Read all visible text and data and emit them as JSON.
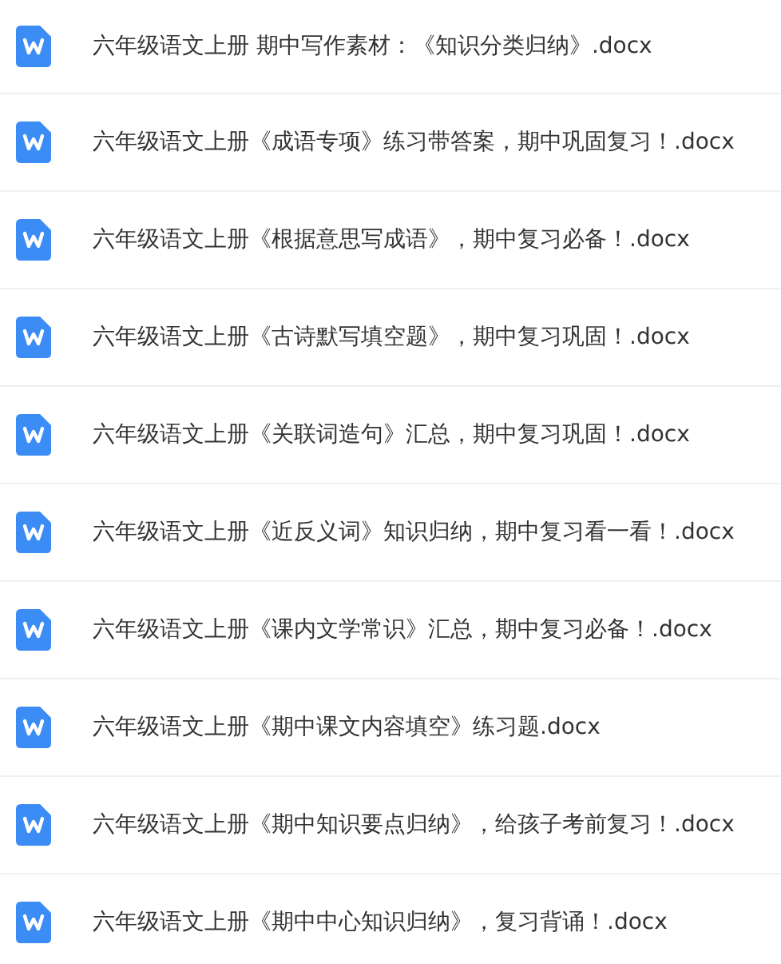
{
  "files": [
    {
      "name": "六年级语文上册 期中写作素材：《知识分类归纳》.docx"
    },
    {
      "name": "六年级语文上册《成语专项》练习带答案，期中巩固复习！.docx"
    },
    {
      "name": "六年级语文上册《根据意思写成语》，期中复习必备！.docx"
    },
    {
      "name": "六年级语文上册《古诗默写填空题》，期中复习巩固！.docx"
    },
    {
      "name": "六年级语文上册《关联词造句》汇总，期中复习巩固！.docx"
    },
    {
      "name": "六年级语文上册《近反义词》知识归纳，期中复习看一看！.docx"
    },
    {
      "name": "六年级语文上册《课内文学常识》汇总，期中复习必备！.docx"
    },
    {
      "name": "六年级语文上册《期中课文内容填空》练习题.docx"
    },
    {
      "name": "六年级语文上册《期中知识要点归纳》，给孩子考前复习！.docx"
    },
    {
      "name": "六年级语文上册《期中中心知识归纳》，复习背诵！.docx"
    }
  ]
}
